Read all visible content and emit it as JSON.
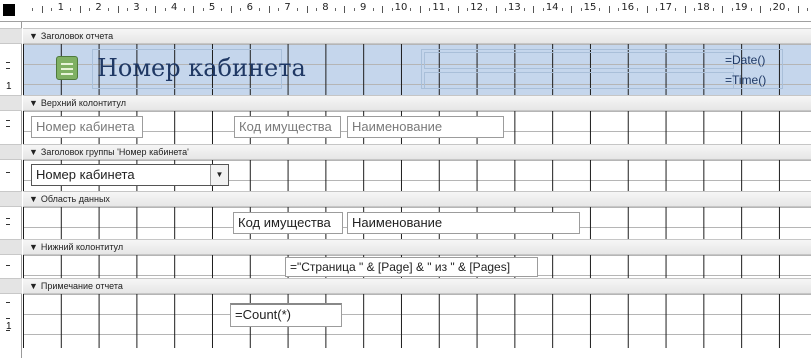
{
  "ruler": {
    "corner_icon": "ruler-corner-square-icon",
    "numbers": [
      "1",
      "2",
      "3",
      "4",
      "5",
      "6",
      "7",
      "8",
      "9",
      "10",
      "11",
      "12",
      "13",
      "14",
      "15",
      "16",
      "17",
      "18",
      "19",
      "20"
    ],
    "left_marks": [
      "1",
      "1"
    ]
  },
  "sections": {
    "report_header": {
      "label": "Заголовок отчета",
      "icon": "collapse-arrow-icon"
    },
    "page_header": {
      "label": "Верхний колонтитул",
      "icon": "collapse-arrow-icon"
    },
    "group_header": {
      "label": "Заголовок группы 'Номер кабинета'",
      "icon": "collapse-arrow-icon"
    },
    "detail": {
      "label": "Область данных",
      "icon": "collapse-arrow-icon"
    },
    "page_footer": {
      "label": "Нижний колонтитул",
      "icon": "collapse-arrow-icon"
    },
    "report_footer": {
      "label": "Примечание отчета",
      "icon": "collapse-arrow-icon"
    }
  },
  "report_header": {
    "logo_icon": "report-logo-icon",
    "title": "Номер кабинета",
    "date_expr": "=Date()",
    "time_expr": "=Time()"
  },
  "page_header": {
    "labels": [
      "Номер кабинета",
      "Код имущества",
      "Наименование"
    ]
  },
  "group_header": {
    "combo_value": "Номер кабинета",
    "combo_icon": "dropdown-arrow-icon"
  },
  "detail": {
    "fields": [
      "Код имущества",
      "Наименование"
    ]
  },
  "page_footer": {
    "expr": "=\"Страница \" & [Page] & \" из \" & [Pages]"
  },
  "report_footer": {
    "expr": "=Count(*)"
  },
  "colors": {
    "report_header_fill": "#c5d6ec",
    "title_text": "#1f3864",
    "section_bar": "#e6e6e6"
  }
}
